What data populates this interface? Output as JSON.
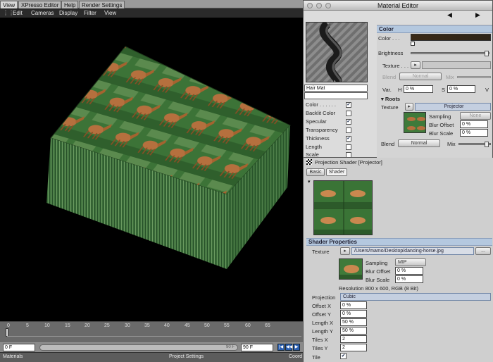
{
  "tabs": [
    "View",
    "XPresso Editor",
    "Help",
    "Render Settings"
  ],
  "viewport_menu": [
    "Edit",
    "Cameras",
    "Display",
    "Filter",
    "View"
  ],
  "timeline": {
    "ticks": [
      "0",
      "5",
      "10",
      "15",
      "20",
      "25",
      "30",
      "35",
      "40",
      "45",
      "50",
      "55",
      "60",
      "65"
    ],
    "start_field": "0 F",
    "slider_label": "90 F",
    "end_field": "90 F"
  },
  "bottom_tabs": [
    "Materials",
    "Project Settings",
    "Coord"
  ],
  "material_editor": {
    "title": "Material Editor",
    "material_name": "Hair Mat",
    "channels": [
      {
        "label": "Color . . . . . .",
        "checked": true
      },
      {
        "label": "Backlit Color",
        "checked": false
      },
      {
        "label": "Specular",
        "checked": true
      },
      {
        "label": "Transparency",
        "checked": false
      },
      {
        "label": "Thickness",
        "checked": true
      },
      {
        "label": "Length",
        "checked": false
      },
      {
        "label": "Scale",
        "checked": false
      }
    ],
    "section": "Color",
    "color_label": "Color . . .",
    "brightness_label": "Brightness",
    "texture_label": "Texture . . .",
    "blend_label": "Blend",
    "blend_value": "Normal",
    "mix_label": "Mix",
    "var_label": "Var.",
    "h_label": "H",
    "h_value": "0 %",
    "s_label": "S",
    "s_value": "0 %",
    "v_label": "V",
    "roots_label": "Roots",
    "roots_texture_label": "Texture",
    "roots_texture_value": "Projector",
    "sampling_label": "Sampling",
    "sampling_value": "None",
    "blur_offset_label": "Blur Offset",
    "blur_offset_value": "0 %",
    "blur_scale_label": "Blur Scale",
    "blur_scale_value": "0 %",
    "blend2_label": "Blend",
    "blend2_value": "Normal",
    "mix2_label": "Mix"
  },
  "projection_shader": {
    "title": "Projection Shader [Projector]",
    "tabs": [
      "Basic",
      "Shader"
    ],
    "section": "Shader Properties",
    "texture_label": "Texture",
    "texture_path": "/Users/mamo/Desktop/dancing-horse.jpg",
    "texture_more_button": "...",
    "sampling_label": "Sampling",
    "sampling_value": "MIP",
    "blur_offset_label": "Blur Offset",
    "blur_offset_value": "0 %",
    "blur_scale_label": "Blur Scale",
    "blur_scale_value": "0 %",
    "resolution": "Resolution 800 x 600, RGB (8 Bit)",
    "projection_label": "Projection",
    "projection_value": "Cubic",
    "offset_x_label": "Offset X",
    "offset_x_value": "0 %",
    "offset_y_label": "Offset Y",
    "offset_y_value": "0 %",
    "length_x_label": "Length X",
    "length_x_value": "50 %",
    "length_y_label": "Length Y",
    "length_y_value": "50 %",
    "tiles_x_label": "Tiles X",
    "tiles_x_value": "2",
    "tiles_y_label": "Tiles Y",
    "tiles_y_value": "2",
    "tile_label": "Tile"
  },
  "colors": {
    "accent": "#2b5fb0",
    "section_header": "#b4c8df",
    "grass": "#3f7a3a",
    "horse": "#b5703e"
  },
  "icons": [
    "arrow-left-icon",
    "arrow-right-icon",
    "dropdown-arrow-icon",
    "play-icon",
    "checkerboard-icon"
  ]
}
